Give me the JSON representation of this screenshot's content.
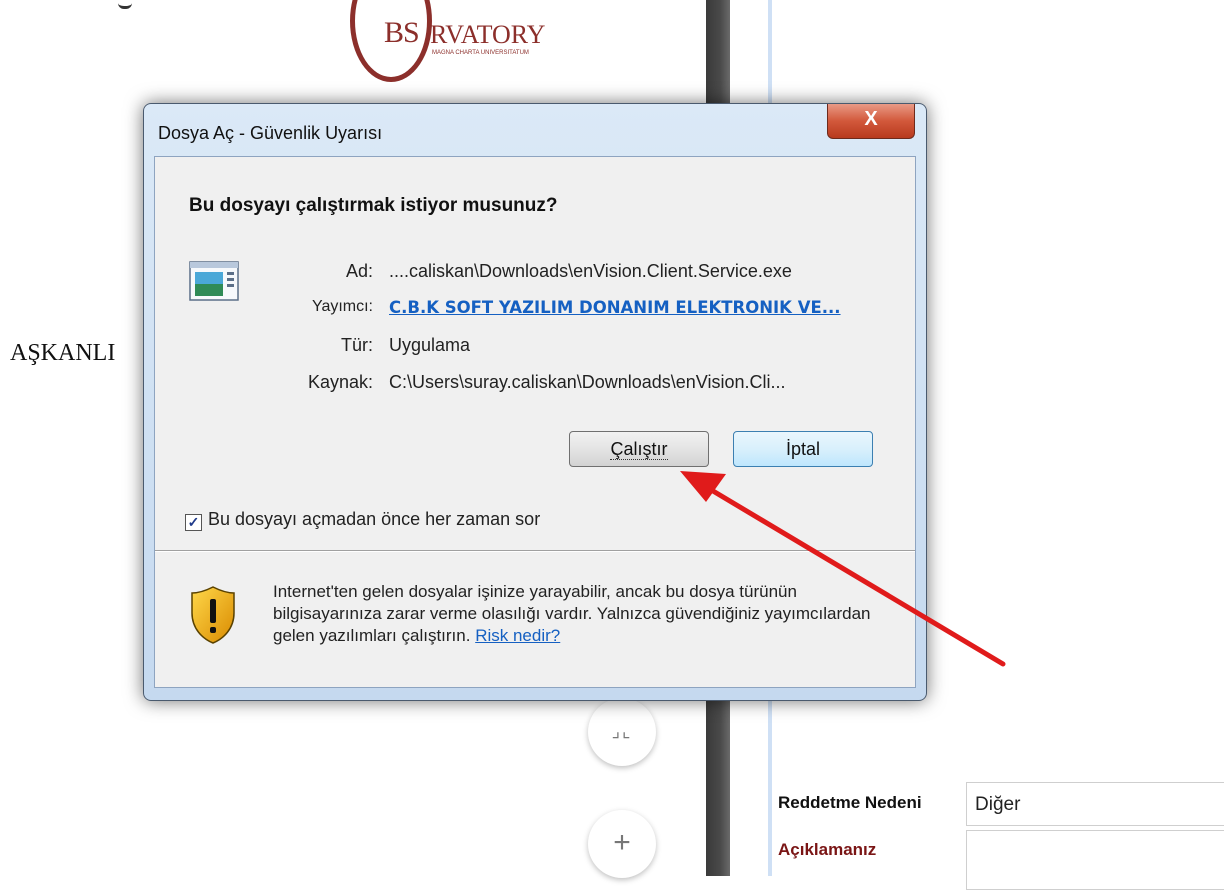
{
  "background": {
    "logo": {
      "prefix": "BS",
      "suffix": "RVATORY",
      "subtitle": "MAGNA CHARTA UNIVERSITATUM"
    },
    "heading_fragment": "AŞKANLI",
    "form": {
      "reddetme_label": "Reddetme Nedeni",
      "reddetme_value": "Diğer",
      "aciklama_label": "Açıklamanız"
    },
    "fab_shrink_icon": "collapse-icon",
    "fab_plus_icon": "plus-icon",
    "fab_shrink_glyph": "⌟⌞",
    "fab_plus_glyph": "+"
  },
  "dialog": {
    "title": "Dosya Aç - Güvenlik Uyarısı",
    "close_glyph": "X",
    "question": "Bu dosyayı çalıştırmak istiyor musunuz?",
    "file_icon": "application-window-icon",
    "fields": [
      {
        "label": "Ad:",
        "value": "....caliskan\\Downloads\\enVision.Client.Service.exe",
        "link": false
      },
      {
        "label": "Yayımcı:",
        "value": "C.B.K SOFT YAZILIM DONANIM ELEKTRONIK VE...",
        "link": true
      },
      {
        "label": "Tür:",
        "value": "Uygulama",
        "link": false
      },
      {
        "label": "Kaynak:",
        "value": "C:\\Users\\suray.caliskan\\Downloads\\enVision.Cli...",
        "link": false
      }
    ],
    "run_button": "Çalıştır",
    "cancel_button": "İptal",
    "checkbox_label": "Bu dosyayı açmadan önce her zaman sor",
    "checkbox_checked": true,
    "checkbox_glyph": "✓",
    "warning_icon": "shield-warning-icon",
    "warning_text": "Internet'ten gelen dosyalar işinize yarayabilir, ancak bu dosya türünün bilgisayarınıza zarar verme olasılığı vardır. Yalnızca güvendiğiniz yayımcılardan gelen yazılımları çalıştırın.",
    "risk_link": "Risk nedir?"
  },
  "annotation": {
    "arrow_color": "#e01b1b"
  }
}
